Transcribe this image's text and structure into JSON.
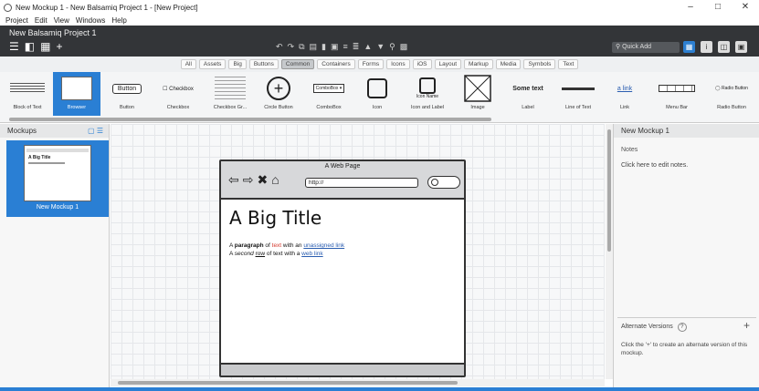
{
  "window": {
    "title": "New Mockup 1 - New Balsamiq Project 1 - [New Project]",
    "controls": [
      "–",
      "□",
      "✕"
    ]
  },
  "menu": [
    "Project",
    "Edit",
    "View",
    "Windows",
    "Help"
  ],
  "project": {
    "title": "New Balsamiq Project 1",
    "quick_add": "Quick Add"
  },
  "categories": [
    "All",
    "Assets",
    "Big",
    "Buttons",
    "Common",
    "Containers",
    "Forms",
    "Icons",
    "iOS",
    "Layout",
    "Markup",
    "Media",
    "Symbols",
    "Text"
  ],
  "selected_category": "Common",
  "library": [
    {
      "label": "Block of Text",
      "preview": "block-of-text"
    },
    {
      "label": "Browser",
      "preview": "browser",
      "selected": true
    },
    {
      "label": "Button",
      "preview": "button",
      "text": "Button"
    },
    {
      "label": "Checkbox",
      "preview": "checkbox",
      "text": "Checkbox"
    },
    {
      "label": "Checkbox Gr...",
      "preview": "checkbox-group"
    },
    {
      "label": "Circle Button",
      "preview": "circle-button"
    },
    {
      "label": "ComboBox",
      "preview": "combobox",
      "text": "ComboBox"
    },
    {
      "label": "Icon",
      "preview": "icon"
    },
    {
      "label": "Icon and Label",
      "preview": "icon-and-label",
      "text": "Icon Name"
    },
    {
      "label": "Image",
      "preview": "image"
    },
    {
      "label": "Label",
      "preview": "label",
      "text": "Some text"
    },
    {
      "label": "Line of Text",
      "preview": "line-of-text"
    },
    {
      "label": "Link",
      "preview": "link",
      "text": "a link"
    },
    {
      "label": "Menu Bar",
      "preview": "menu-bar"
    },
    {
      "label": "Radio Button",
      "preview": "radio-button",
      "text": "Radio Button"
    }
  ],
  "mockups_panel": {
    "title": "Mockups",
    "items": [
      {
        "name": "New Mockup 1",
        "thumb_title": "A Big Title"
      }
    ]
  },
  "browser_mockup": {
    "window_title": "A Web Page",
    "url": "http://",
    "big_title": "A Big Title",
    "line1": {
      "bold": "paragraph",
      "red": "text",
      "link": "unassigned link"
    },
    "line2": {
      "italic": "second",
      "under": "row",
      "link": "web link"
    }
  },
  "right_panel": {
    "mockup_name": "New Mockup 1",
    "notes_label": "Notes",
    "notes_hint": "Click here to edit notes.",
    "alt_versions": "Alternate Versions",
    "alt_desc": "Click the '+' to create an alternate version of this mockup."
  },
  "icons": {
    "app": "balsamiq-icon",
    "hamburger": "hamburger-icon",
    "layout": "layout-icon",
    "grid": "grid-icon",
    "plus": "plus-icon",
    "search": "search-icon",
    "info": "info-icon"
  }
}
